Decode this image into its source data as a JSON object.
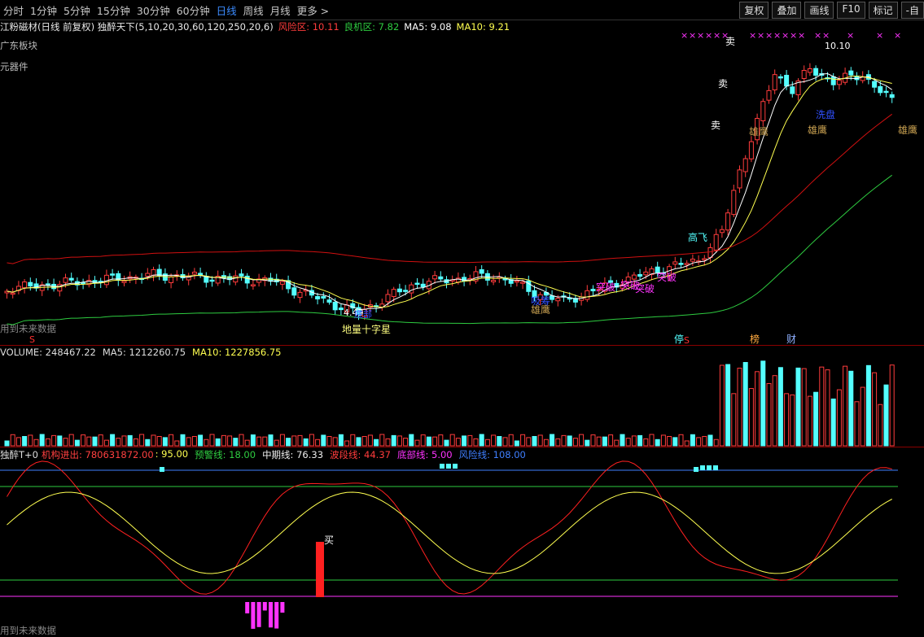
{
  "toolbar": {
    "timeframes": [
      "分时",
      "1分钟",
      "5分钟",
      "15分钟",
      "30分钟",
      "60分钟",
      "日线",
      "周线",
      "月线",
      "更多 >"
    ],
    "active": "日线",
    "buttons": [
      "复权",
      "叠加",
      "画线",
      "F10",
      "标记",
      "-自"
    ]
  },
  "info": {
    "title": "江粉磁材(日线 前复权) 独醉天下(5,10,20,30,60,120,250,20,6)",
    "risk_label": "风险区: 10.11",
    "opportunity_label": "良机区: 7.82",
    "ma5_label": "MA5: 9.08",
    "ma10_label": "MA10: 9.21"
  },
  "sector": [
    "广东板块",
    "元器件"
  ],
  "annotations": {
    "future_note": "用到未来数据",
    "cross_star": "地量十字星",
    "low_price": "4.49",
    "high_price": "10.10",
    "breakout": "突破",
    "gaofei": "高飞",
    "xiongying": "雄鹰",
    "sell": "卖",
    "buy": "买",
    "blue_a": "吸筹",
    "blue_b": "洗盘",
    "blue_c": "底部",
    "ting": "停",
    "bang": "榜",
    "cai": "财",
    "s_mark": "S"
  },
  "volume": {
    "volume_label": "VOLUME: 248467.22",
    "ma5_label": "MA5: 1212260.75",
    "ma10_label": "MA10: 1227856.75"
  },
  "indicator": {
    "name": "独醉T+0",
    "inst_label": "机构进出: 780631872.00",
    "yellow_label": ": 95.00",
    "warn_label": "预警线: 18.00",
    "mid_label": "中期线: 76.33",
    "band_label": "波段线: 44.37",
    "bottom_label": "底部线: 5.00",
    "risk_label": "风险线: 108.00"
  },
  "colors": {
    "up": "#ff3c3c",
    "down": "#54ffff",
    "ma_white": "#ffffff",
    "ma_yellow": "#ffff50",
    "ma_green": "#2ecc40",
    "ma_red": "#d01010",
    "magenta": "#ff33ff",
    "blue_line": "#3f7fff"
  }
}
